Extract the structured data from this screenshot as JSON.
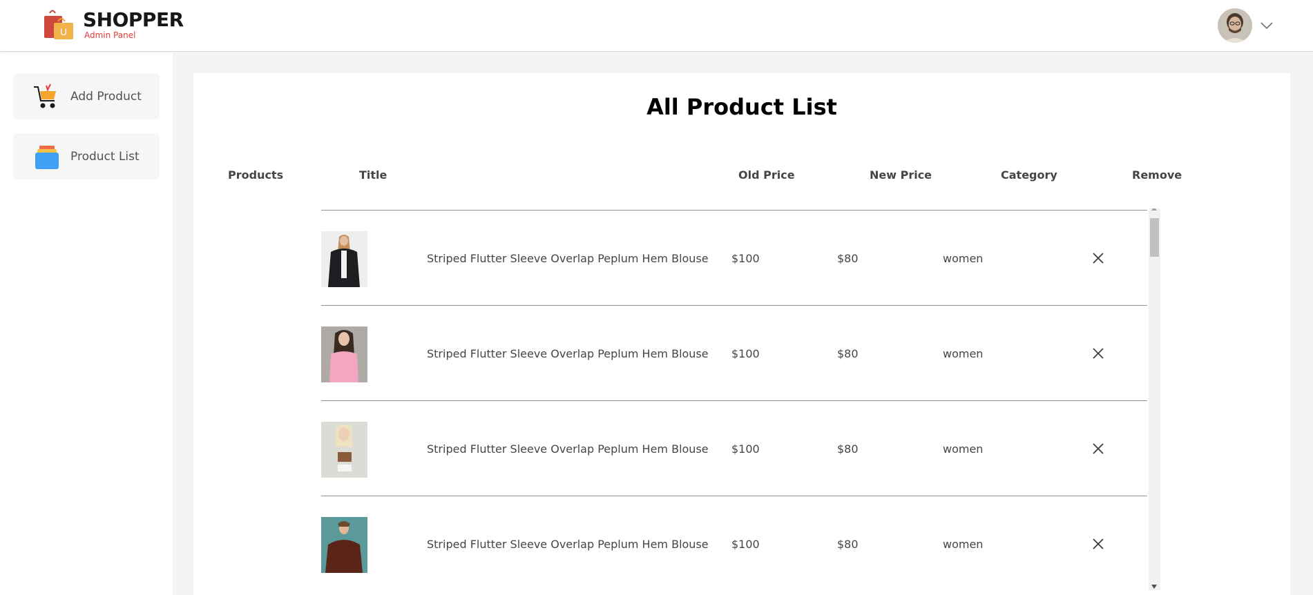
{
  "navbar": {
    "brand": "SHOPPER",
    "subtitle": "Admin Panel",
    "logo_letter": "U"
  },
  "sidebar": {
    "items": [
      {
        "label": "Add Product",
        "icon": "cart-icon"
      },
      {
        "label": "Product List",
        "icon": "list-icon"
      }
    ]
  },
  "main": {
    "title": "All Product List",
    "columns": [
      "Products",
      "Title",
      "Old Price",
      "New Price",
      "Category",
      "Remove"
    ],
    "rows": [
      {
        "title": "Striped Flutter Sleeve Overlap Peplum Hem Blouse",
        "old_price": "$100",
        "new_price": "$80",
        "category": "women"
      },
      {
        "title": "Striped Flutter Sleeve Overlap Peplum Hem Blouse",
        "old_price": "$100",
        "new_price": "$80",
        "category": "women"
      },
      {
        "title": "Striped Flutter Sleeve Overlap Peplum Hem Blouse",
        "old_price": "$100",
        "new_price": "$80",
        "category": "women"
      },
      {
        "title": "Striped Flutter Sleeve Overlap Peplum Hem Blouse",
        "old_price": "$100",
        "new_price": "$80",
        "category": "women"
      }
    ]
  },
  "colors": {
    "brand_red": "#e23a3a",
    "panel_bg": "#f4f4f4",
    "divider": "#8f8f8f"
  }
}
